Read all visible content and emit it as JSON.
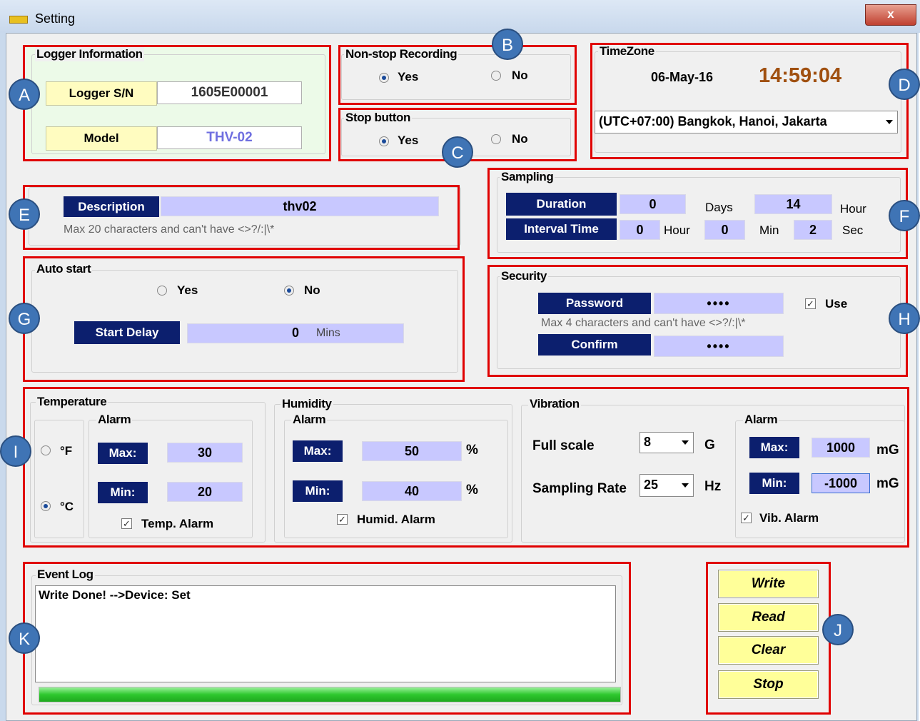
{
  "window": {
    "title": "Setting",
    "close_label": "x"
  },
  "callouts": [
    "A",
    "B",
    "C",
    "D",
    "E",
    "F",
    "G",
    "H",
    "I",
    "J",
    "K"
  ],
  "logger": {
    "group_title": "Logger Information",
    "sn_label": "Logger S/N",
    "sn_value": "1605E00001",
    "model_label": "Model",
    "model_value": "THV-02"
  },
  "nonstop": {
    "group_title": "Non-stop Recording",
    "yes": "Yes",
    "no": "No",
    "selected": "Yes"
  },
  "stopbtn": {
    "group_title": "Stop button",
    "yes": "Yes",
    "no": "No",
    "selected": "Yes"
  },
  "timezone": {
    "group_title": "TimeZone",
    "date": "06-May-16",
    "time": "14:59:04",
    "zone": "(UTC+07:00) Bangkok, Hanoi, Jakarta"
  },
  "description": {
    "label": "Description",
    "value": "thv02",
    "hint": "Max 20 characters and can't have <>?/:|\\*"
  },
  "sampling": {
    "group_title": "Sampling",
    "duration_label": "Duration",
    "duration_days": "0",
    "days_unit": "Days",
    "duration_hours": "14",
    "hour_unit": "Hour",
    "interval_label": "Interval Time",
    "interval_hour": "0",
    "interval_hour_unit": "Hour",
    "interval_min": "0",
    "min_unit": "Min",
    "interval_sec": "2",
    "sec_unit": "Sec"
  },
  "autostart": {
    "group_title": "Auto start",
    "yes": "Yes",
    "no": "No",
    "selected": "No",
    "delay_label": "Start Delay",
    "delay_value": "0",
    "delay_unit": "Mins"
  },
  "security": {
    "group_title": "Security",
    "password_label": "Password",
    "password_value": "••••",
    "use_label": "Use",
    "hint": "Max 4 characters and can't have <>?/:|\\*",
    "confirm_label": "Confirm",
    "confirm_value": "••••"
  },
  "temperature": {
    "group_title": "Temperature",
    "alarm_title": "Alarm",
    "unit_f": "°F",
    "unit_c": "°C",
    "selected_unit": "°C",
    "max_label": "Max:",
    "max_value": "30",
    "min_label": "Min:",
    "min_value": "20",
    "alarm_check_label": "Temp. Alarm"
  },
  "humidity": {
    "group_title": "Humidity",
    "alarm_title": "Alarm",
    "max_label": "Max:",
    "max_value": "50",
    "min_label": "Min:",
    "min_value": "40",
    "unit": "%",
    "alarm_check_label": "Humid. Alarm"
  },
  "vibration": {
    "group_title": "Vibration",
    "full_scale_label": "Full scale",
    "full_scale_value": "8",
    "full_scale_unit": "G",
    "rate_label": "Sampling Rate",
    "rate_value": "25",
    "rate_unit": "Hz",
    "alarm_title": "Alarm",
    "max_label": "Max:",
    "max_value": "1000",
    "min_label": "Min:",
    "min_value": "-1000",
    "unit": "mG",
    "alarm_check_label": "Vib. Alarm"
  },
  "eventlog": {
    "group_title": "Event Log",
    "text": "Write Done! -->Device: Set",
    "progress": 1.0
  },
  "buttons": {
    "write": "Write",
    "read": "Read",
    "clear": "Clear",
    "stop": "Stop"
  },
  "colors": {
    "callout_red": "#e00000",
    "badge_blue": "#3f74b5",
    "label_navy": "#0c1f6e",
    "field_lavender": "#c8c8ff",
    "button_yellow": "#ffff99",
    "time_orange": "#a05010",
    "progress_green": "#2ec82e"
  }
}
